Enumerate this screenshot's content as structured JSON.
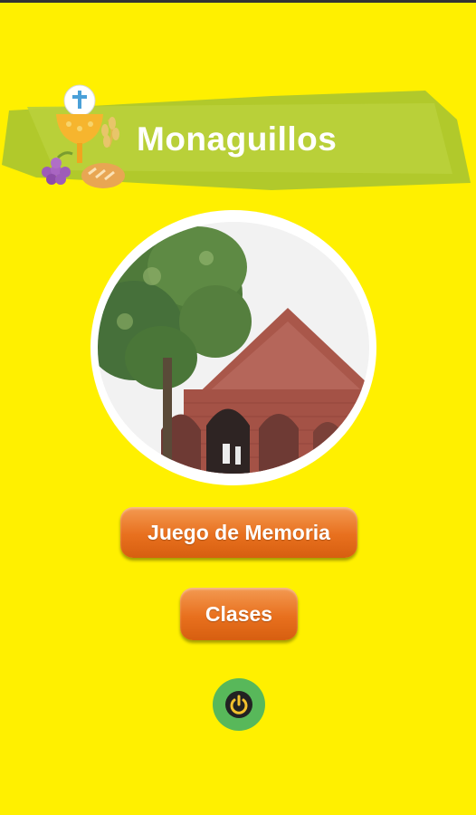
{
  "app": {
    "title": "Monaguillos"
  },
  "menu": {
    "memory_game_label": "Juego de Memoria",
    "classes_label": "Clases"
  },
  "icons": {
    "logo": "chalice-host-grapes-bread-icon",
    "church_photo": "church-photo",
    "power": "power-icon"
  },
  "colors": {
    "background": "#FFF000",
    "banner": "#B3CD2F",
    "button": "#E8701E",
    "power_button": "#58B85A"
  }
}
